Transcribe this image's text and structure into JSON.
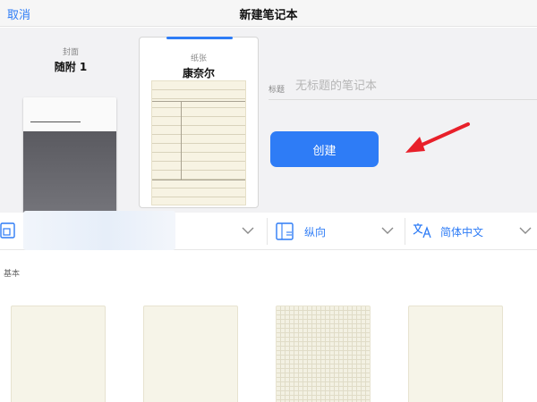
{
  "navbar": {
    "cancel_label": "取消",
    "title": "新建笔记本"
  },
  "cover": {
    "caption": "封面",
    "name": "随附 1"
  },
  "paper": {
    "caption": "纸张",
    "name": "康奈尔"
  },
  "title_field": {
    "label": "标题",
    "placeholder": "无标题的笔记本",
    "value": ""
  },
  "create_button": {
    "label": "创建"
  },
  "options": {
    "orientation": {
      "label": "纵向",
      "icon": "orientation-icon"
    },
    "language": {
      "label": "简体中文",
      "icon": "translate-icon"
    },
    "size": {
      "icon": "page-size-icon"
    }
  },
  "section": {
    "label": "基本"
  },
  "templates": [
    {
      "style": "plain"
    },
    {
      "style": "plain"
    },
    {
      "style": "grid"
    },
    {
      "style": "plain"
    }
  ],
  "colors": {
    "accent": "#2e7cf6",
    "annotation_arrow": "#e8202a",
    "paper": "#f7f3e3",
    "header_bg": "#f2f2f4"
  }
}
